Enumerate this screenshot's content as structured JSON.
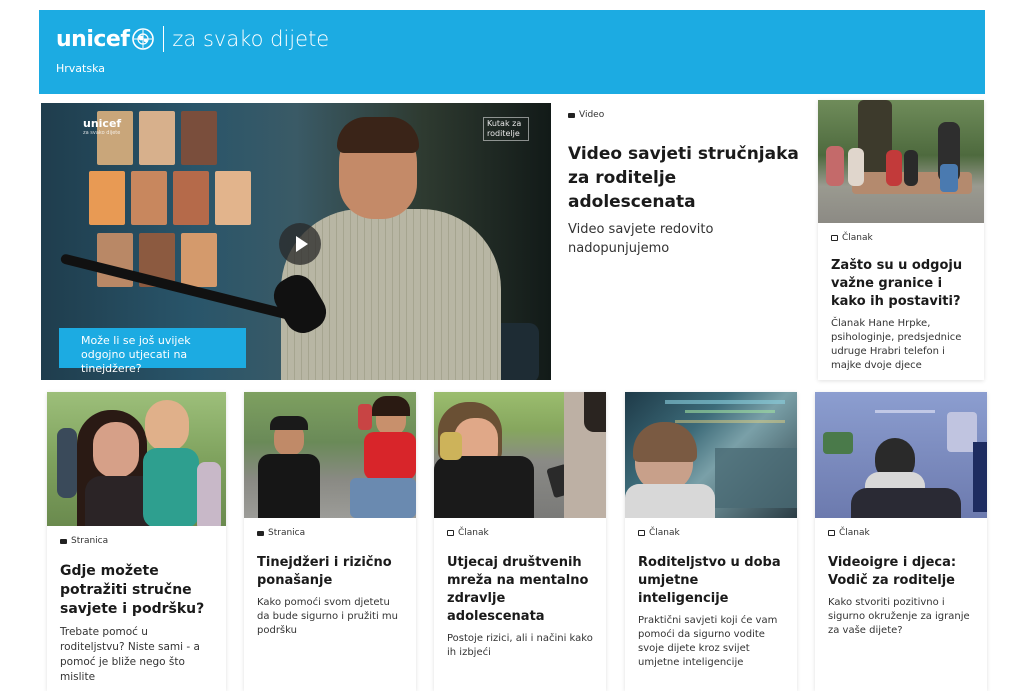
{
  "header": {
    "logo_word": "unicef",
    "tagline": "za svako dijete",
    "country": "Hrvatska",
    "background": "#1cabe2"
  },
  "hero": {
    "video_logo": "unicef",
    "video_logo_sub": "za svako dijete",
    "video_mark": "Kutak za roditelje",
    "caption": "Može li se još uvijek odgojno utjecati na tinejdžere?",
    "play_icon": "play-icon"
  },
  "feature": {
    "type": "Video",
    "title": "Video savjeti stručnjaka za roditelje adolescenata",
    "subtitle": "Video savjete redovito nadopunjujemo"
  },
  "side_card": {
    "type": "Članak",
    "title": "Zašto su u odgoju važne granice i kako ih postaviti?",
    "description": "Članak Hane Hrpke, psihologinje, predsjednice udruge Hrabri telefon i majke dvoje djece"
  },
  "cards": [
    {
      "type": "Stranica",
      "title": "Gdje možete potražiti stručne savjete i podršku?",
      "description": "Trebate pomoć u roditeljstvu? Niste sami - a pomoć je bliže nego što mislite"
    },
    {
      "type": "Stranica",
      "title": "Tinejdžeri i rizično ponašanje",
      "description": "Kako pomoći svom djetetu da bude sigurno i pružiti mu podršku"
    },
    {
      "type": "Članak",
      "title": "Utjecaj društvenih mreža na mentalno zdravlje adolescenata",
      "description": "Postoje rizici, ali i načini kako ih izbjeći"
    },
    {
      "type": "Članak",
      "title": "Roditeljstvo u doba umjetne inteligencije",
      "description": "Praktični savjeti koji će vam pomoći da sigurno vodite svoje dijete kroz svijet umjetne inteligencije"
    },
    {
      "type": "Članak",
      "title": "Videoigre i djeca: Vodič za roditelje",
      "description": "Kako stvoriti pozitivno i sigurno okruženje za igranje za vaše dijete?"
    }
  ]
}
